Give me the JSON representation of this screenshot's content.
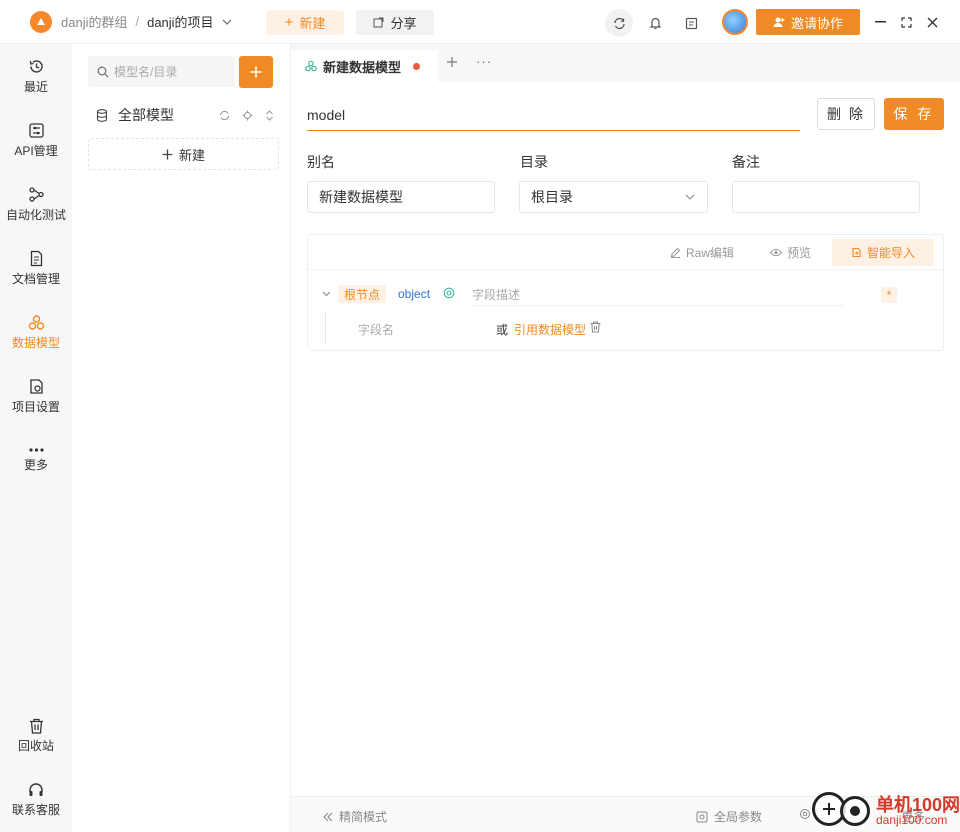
{
  "header": {
    "group": "danji的群组",
    "separator": "/",
    "project": "danji的项目",
    "new_label": "新建",
    "share_label": "分享",
    "invite_label": "邀请协作"
  },
  "nav": {
    "items": [
      {
        "label": "最近",
        "icon": "history-icon"
      },
      {
        "label": "API管理",
        "icon": "api-icon"
      },
      {
        "label": "自动化测试",
        "icon": "flow-icon"
      },
      {
        "label": "文档管理",
        "icon": "document-icon"
      },
      {
        "label": "数据模型",
        "icon": "model-icon",
        "active": true
      },
      {
        "label": "项目设置",
        "icon": "settings-icon"
      },
      {
        "label": "更多",
        "icon": "more-icon"
      }
    ],
    "bottom": [
      {
        "label": "回收站",
        "icon": "trash-icon"
      },
      {
        "label": "联系客服",
        "icon": "headset-icon"
      }
    ]
  },
  "panel": {
    "search_placeholder": "模型名/目录",
    "all_models": "全部模型",
    "new_label": "新建"
  },
  "tabs": {
    "active": "新建数据模型"
  },
  "editor": {
    "model_name": "model",
    "delete_label": "删 除",
    "save_label": "保 存",
    "alias_label": "别名",
    "alias_value": "新建数据模型",
    "dir_label": "目录",
    "dir_value": "根目录",
    "note_label": "备注",
    "note_value": ""
  },
  "schema": {
    "raw_edit": "Raw编辑",
    "preview": "预览",
    "smart_import": "智能导入",
    "root_tag": "根节点",
    "root_type": "object",
    "desc_placeholder": "字段描述",
    "star": "*",
    "field_name_placeholder": "字段名",
    "or_text": "或",
    "ref_model": "引用数据模型"
  },
  "footer": {
    "compact_mode": "精简模式",
    "global_params": "全局参数",
    "more_label": "更多"
  },
  "watermark": {
    "title": "单机100网",
    "url": "danji100.com"
  },
  "colors": {
    "accent": "#f08a24",
    "accent_light": "#fdf1e6",
    "link_blue": "#2f6fd6",
    "unsaved_dot": "#f05a3c"
  }
}
